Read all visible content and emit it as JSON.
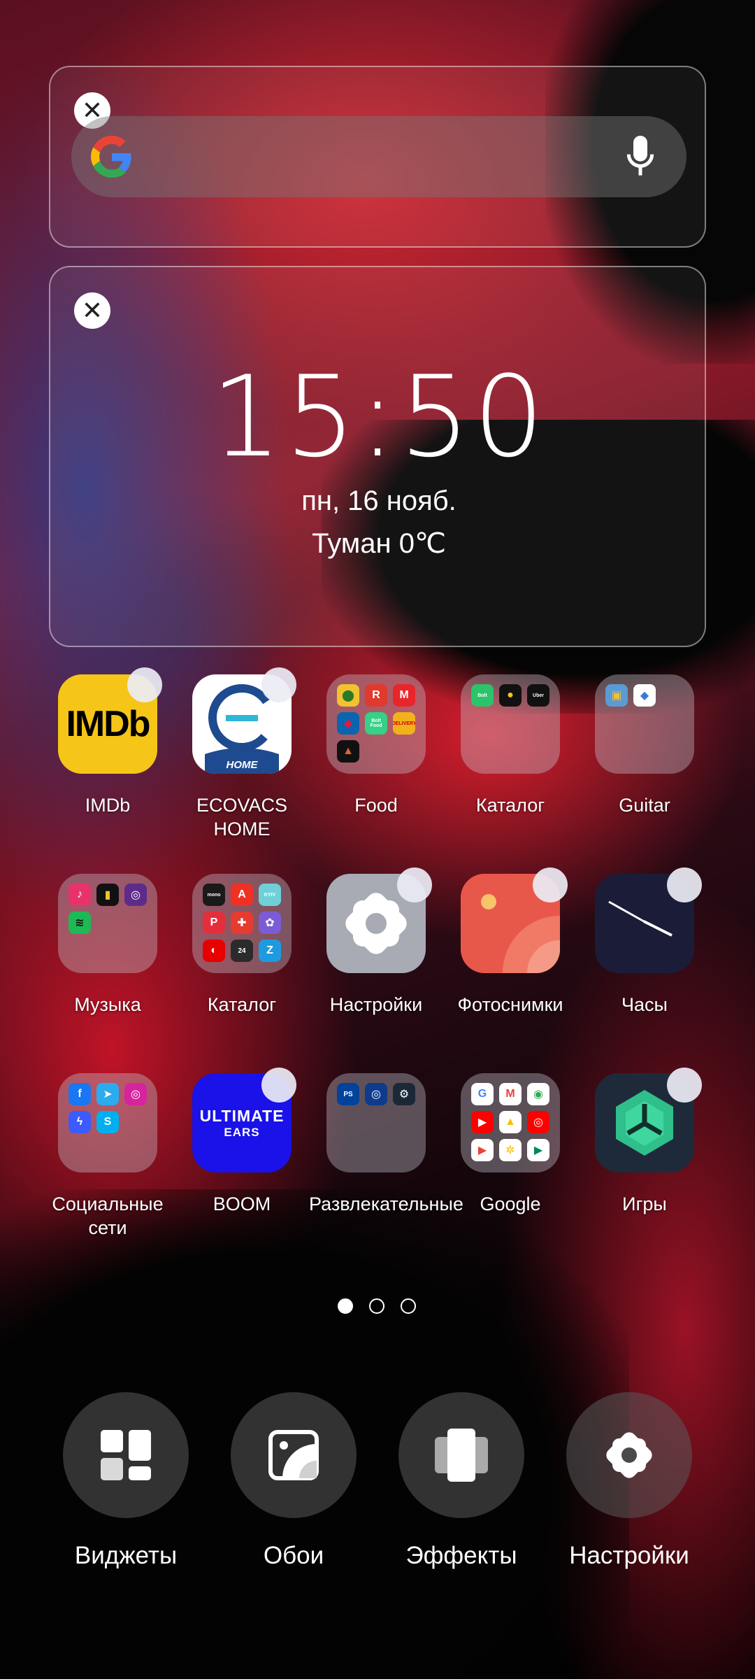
{
  "search_widget": {
    "remove_symbol": "✕",
    "icon": "google-g-logo",
    "mic_icon": "microphone-icon"
  },
  "clock_widget": {
    "remove_symbol": "✕",
    "time": "15:50",
    "date": "пн, 16 нояб.",
    "weather": "Туман 0℃"
  },
  "apps": [
    {
      "label": "IMDb",
      "type": "app",
      "icon": "imdb-icon",
      "icon_text": "IMDb",
      "color": "#F5C518"
    },
    {
      "label": "ECOVACS HOME",
      "type": "app",
      "icon": "ecovacs-icon",
      "icon_text": "HOME",
      "color": "#FFFFFF"
    },
    {
      "label": "Food",
      "type": "folder",
      "icon": "food-folder-icon"
    },
    {
      "label": "Каталог",
      "type": "folder",
      "icon": "catalog-folder-icon"
    },
    {
      "label": "Guitar",
      "type": "folder",
      "icon": "guitar-folder-icon"
    },
    {
      "label": "Музыка",
      "type": "folder",
      "icon": "music-folder-icon"
    },
    {
      "label": "Каталог",
      "type": "folder",
      "icon": "catalog-folder-icon"
    },
    {
      "label": "Настройки",
      "type": "app",
      "icon": "settings-icon",
      "color": "#A8AAB4"
    },
    {
      "label": "Фотоснимки",
      "type": "app",
      "icon": "photos-icon",
      "color": "#E8584A"
    },
    {
      "label": "Часы",
      "type": "app",
      "icon": "clock-icon",
      "color": "#1B1C38"
    },
    {
      "label": "Социальные сети",
      "type": "folder",
      "icon": "social-folder-icon"
    },
    {
      "label": "BOOM",
      "type": "app",
      "icon": "ultimate-ears-icon",
      "icon_text_1": "ULTIMATE",
      "icon_text_2": "EARS",
      "color": "#1A12E8"
    },
    {
      "label": "Развлекательные",
      "type": "folder",
      "icon": "entertainment-folder-icon"
    },
    {
      "label": "Google",
      "type": "folder",
      "icon": "google-folder-icon"
    },
    {
      "label": "Игры",
      "type": "app",
      "icon": "games-icon",
      "color": "#1E2A3A"
    }
  ],
  "folder_minis": {
    "food": [
      {
        "bg": "#F2C230",
        "t": "⬤",
        "c": "#2a7a2a"
      },
      {
        "bg": "#E03A2E",
        "t": "R",
        "c": "#fff"
      },
      {
        "bg": "#E8262A",
        "t": "M",
        "c": "#fff"
      },
      {
        "bg": "#0B64B0",
        "t": "◆",
        "c": "#E3193B"
      },
      {
        "bg": "#34D186",
        "t": "Bolt Food",
        "c": "#fff"
      },
      {
        "bg": "#F2B21B",
        "t": "DELIVERY",
        "c": "#c00"
      },
      {
        "bg": "#111111",
        "t": "▲",
        "c": "#E0642A"
      }
    ],
    "catalog1": [
      {
        "bg": "#2BC46A",
        "t": "Bolt",
        "c": "#fff"
      },
      {
        "bg": "#111111",
        "t": "●",
        "c": "#F5C518"
      },
      {
        "bg": "#111111",
        "t": "Uber",
        "c": "#fff"
      }
    ],
    "guitar": [
      {
        "bg": "#5B9BD5",
        "t": "▣",
        "c": "#F2C230"
      },
      {
        "bg": "#FFFFFF",
        "t": "◆",
        "c": "#3A7BD5"
      }
    ],
    "music": [
      {
        "bg": "#E8336A",
        "t": "♪",
        "c": "#fff"
      },
      {
        "bg": "#111111",
        "t": "▮",
        "c": "#F2C230"
      },
      {
        "bg": "#5E2B8A",
        "t": "◎",
        "c": "#fff"
      },
      {
        "bg": "#1DB954",
        "t": "≋",
        "c": "#111"
      }
    ],
    "catalog2": [
      {
        "bg": "#1a1a1a",
        "t": "mono",
        "c": "#fff"
      },
      {
        "bg": "#EF3124",
        "t": "A",
        "c": "#fff"
      },
      {
        "bg": "#6FD0D8",
        "t": "KYIV",
        "c": "#fff"
      },
      {
        "bg": "#E52E3C",
        "t": "P",
        "c": "#fff"
      },
      {
        "bg": "#E63C2F",
        "t": "✚",
        "c": "#fff"
      },
      {
        "bg": "#7C5CD6",
        "t": "✿",
        "c": "#fff"
      },
      {
        "bg": "#E60000",
        "t": "◐",
        "c": "#fff"
      },
      {
        "bg": "#2B2B2B",
        "t": "24",
        "c": "#fff"
      },
      {
        "bg": "#1E9BE0",
        "t": "Z",
        "c": "#fff"
      }
    ],
    "social": [
      {
        "bg": "#1877F2",
        "t": "f",
        "c": "#fff"
      },
      {
        "bg": "#2AABEE",
        "t": "➤",
        "c": "#fff"
      },
      {
        "bg": "#D6249F",
        "t": "◎",
        "c": "#fff"
      },
      {
        "bg": "#3B5BFF",
        "t": "ϟ",
        "c": "#fff"
      },
      {
        "bg": "#00AFF0",
        "t": "S",
        "c": "#fff"
      }
    ],
    "entertainment": [
      {
        "bg": "#00439C",
        "t": "PS",
        "c": "#fff"
      },
      {
        "bg": "#0E3B8C",
        "t": "◎",
        "c": "#fff"
      },
      {
        "bg": "#1B2838",
        "t": "⚙",
        "c": "#fff"
      }
    ],
    "google": [
      {
        "bg": "#FFFFFF",
        "t": "G",
        "c": "#4285F4"
      },
      {
        "bg": "#FFFFFF",
        "t": "M",
        "c": "#EA4335"
      },
      {
        "bg": "#FFFFFF",
        "t": "◉",
        "c": "#34A853"
      },
      {
        "bg": "#FF0000",
        "t": "▶",
        "c": "#fff"
      },
      {
        "bg": "#FFFFFF",
        "t": "▲",
        "c": "#FBBC04"
      },
      {
        "bg": "#FF0000",
        "t": "◎",
        "c": "#fff"
      },
      {
        "bg": "#FFFFFF",
        "t": "▶",
        "c": "#EA4335"
      },
      {
        "bg": "#FFFFFF",
        "t": "✲",
        "c": "#FBBC04"
      },
      {
        "bg": "#FFFFFF",
        "t": "▶",
        "c": "#01875F"
      }
    ]
  },
  "pager": {
    "count": 3,
    "active_index": 0
  },
  "edit_bar": [
    {
      "label": "Виджеты",
      "icon": "widgets-icon"
    },
    {
      "label": "Обои",
      "icon": "wallpaper-icon"
    },
    {
      "label": "Эффекты",
      "icon": "effects-icon"
    },
    {
      "label": "Настройки",
      "icon": "settings-icon"
    }
  ]
}
